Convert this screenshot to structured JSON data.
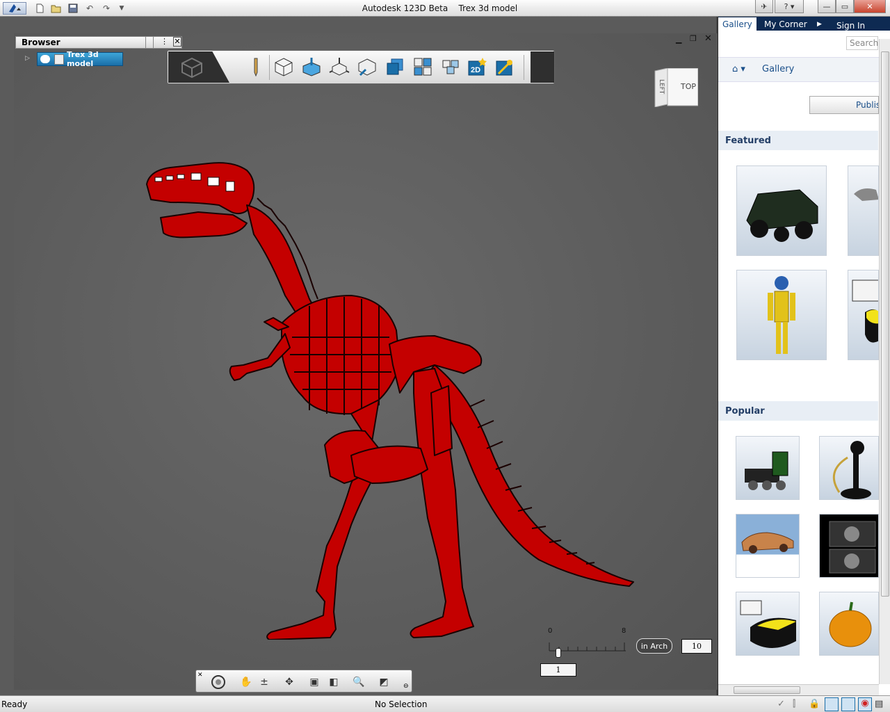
{
  "app": {
    "title": "Autodesk 123D Beta    Trex 3d model"
  },
  "browser": {
    "title": "Browser",
    "tree_item": "Trex 3d model"
  },
  "viewcube": {
    "left": "LEFT",
    "top": "TOP"
  },
  "scale": {
    "tick_start": "0",
    "tick_end": "8",
    "units": "in Arch",
    "value": "10",
    "slider_value": "1"
  },
  "status": {
    "left": "Ready",
    "center": "No Selection"
  },
  "gallery": {
    "tabs": [
      "Gallery",
      "My Corner",
      "Sign In"
    ],
    "search_placeholder": "Search",
    "breadcrumb": "Gallery",
    "publish_button": "Publis",
    "featured_title": "Featured",
    "popular_title": "Popular",
    "featured_items": [
      "jeep-model",
      "wrench-model",
      "robot-model",
      "cylinder-model"
    ],
    "popular_items": [
      "train-model",
      "candlestick-phone-model",
      "car-model",
      "camera-model",
      "cheese-model",
      "pumpkin-model"
    ]
  },
  "colors": {
    "model": "#c40000",
    "accent": "#1a6ea8",
    "nav_dark": "#0e2a52",
    "section_text": "#233e66"
  },
  "toolbar_icons": [
    "pencil-icon",
    "box-icon",
    "extrude-icon",
    "move-icon",
    "tweak-icon",
    "combine-icon",
    "pattern-icon",
    "group-icon",
    "2d-icon",
    "magic-icon"
  ],
  "nav_icons": [
    "orbit-icon",
    "pan-icon",
    "zoom-icon",
    "look-at-icon",
    "fit-icon",
    "view-icon",
    "zoom-window-icon",
    "visual-style-icon"
  ]
}
